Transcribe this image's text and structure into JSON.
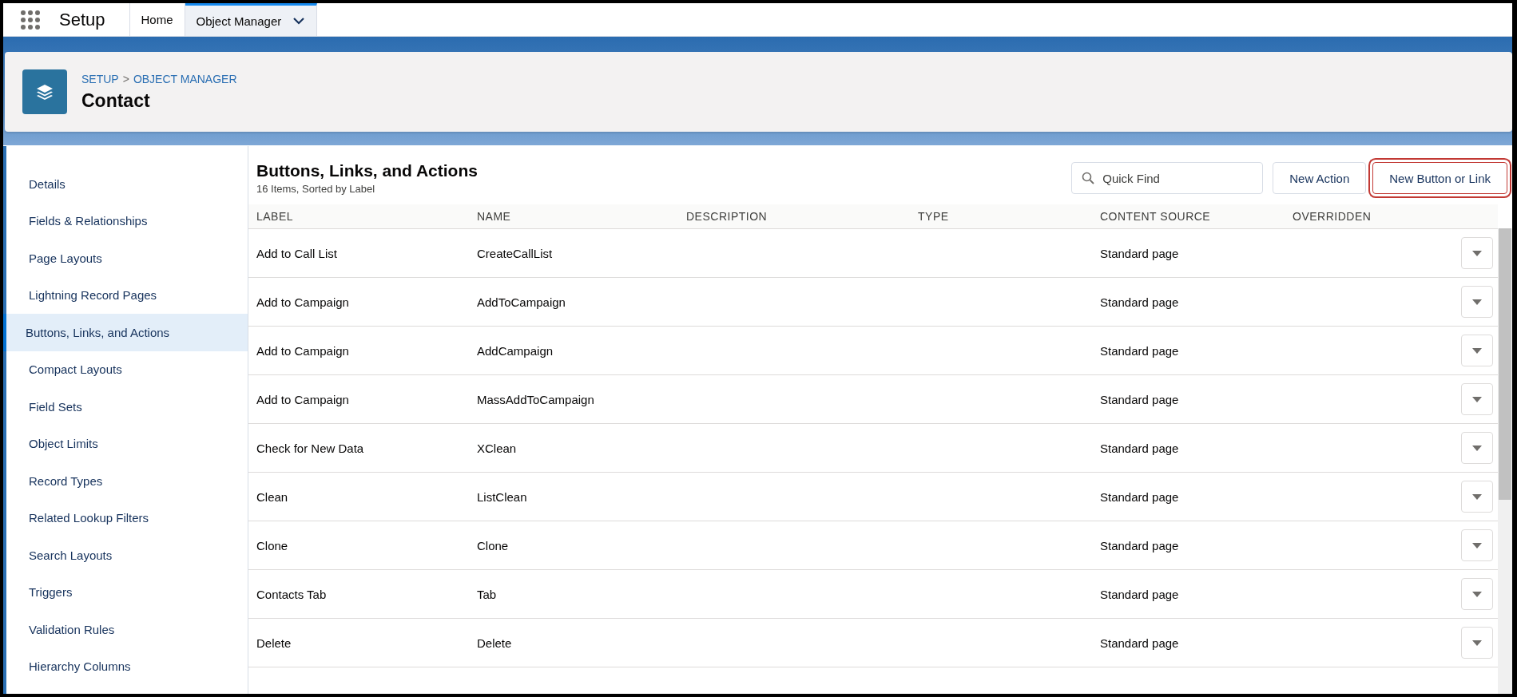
{
  "top_nav": {
    "app_name": "Setup",
    "tabs": [
      {
        "label": "Home",
        "selected": false,
        "has_menu": false
      },
      {
        "label": "Object Manager",
        "selected": true,
        "has_menu": true
      }
    ]
  },
  "header": {
    "breadcrumb": [
      "SETUP",
      "OBJECT MANAGER"
    ],
    "separator": ">",
    "title": "Contact"
  },
  "sidebar": {
    "items": [
      {
        "label": "Details",
        "selected": false
      },
      {
        "label": "Fields & Relationships",
        "selected": false
      },
      {
        "label": "Page Layouts",
        "selected": false
      },
      {
        "label": "Lightning Record Pages",
        "selected": false
      },
      {
        "label": "Buttons, Links, and Actions",
        "selected": true
      },
      {
        "label": "Compact Layouts",
        "selected": false
      },
      {
        "label": "Field Sets",
        "selected": false
      },
      {
        "label": "Object Limits",
        "selected": false
      },
      {
        "label": "Record Types",
        "selected": false
      },
      {
        "label": "Related Lookup Filters",
        "selected": false
      },
      {
        "label": "Search Layouts",
        "selected": false
      },
      {
        "label": "Triggers",
        "selected": false
      },
      {
        "label": "Validation Rules",
        "selected": false
      },
      {
        "label": "Hierarchy Columns",
        "selected": false
      }
    ]
  },
  "main": {
    "title": "Buttons, Links, and Actions",
    "subtitle": "16 Items, Sorted by Label",
    "search": {
      "placeholder": "Quick Find"
    },
    "buttons": [
      {
        "label": "New Action",
        "highlighted": false
      },
      {
        "label": "New Button or Link",
        "highlighted": true
      }
    ],
    "table": {
      "columns": [
        "LABEL",
        "NAME",
        "DESCRIPTION",
        "TYPE",
        "CONTENT SOURCE",
        "OVERRIDDEN"
      ],
      "rows": [
        [
          "Add to Call List",
          "CreateCallList",
          "",
          "",
          "Standard page",
          ""
        ],
        [
          "Add to Campaign",
          "AddToCampaign",
          "",
          "",
          "Standard page",
          ""
        ],
        [
          "Add to Campaign",
          "AddCampaign",
          "",
          "",
          "Standard page",
          ""
        ],
        [
          "Add to Campaign",
          "MassAddToCampaign",
          "",
          "",
          "Standard page",
          ""
        ],
        [
          "Check for New Data",
          "XClean",
          "",
          "",
          "Standard page",
          ""
        ],
        [
          "Clean",
          "ListClean",
          "",
          "",
          "Standard page",
          ""
        ],
        [
          "Clone",
          "Clone",
          "",
          "",
          "Standard page",
          ""
        ],
        [
          "Contacts Tab",
          "Tab",
          "",
          "",
          "Standard page",
          ""
        ],
        [
          "Delete",
          "Delete",
          "",
          "",
          "Standard page",
          ""
        ]
      ]
    }
  }
}
